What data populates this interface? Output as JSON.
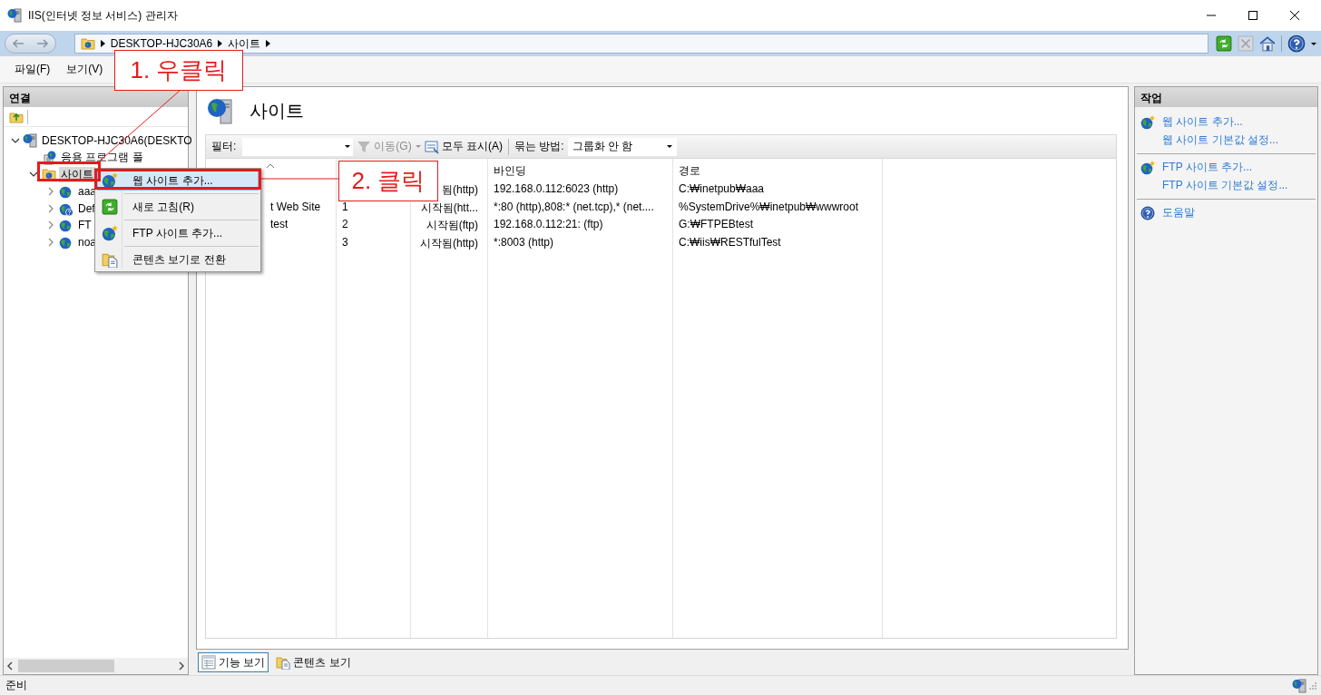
{
  "window": {
    "title": "IIS(인터넷 정보 서비스) 관리자"
  },
  "address_bar": {
    "crumbs": [
      "DESKTOP-HJC30A6",
      "사이트"
    ]
  },
  "menu_bar": [
    "파일(F)",
    "보기(V)"
  ],
  "connections": {
    "title": "연결",
    "tree": [
      {
        "label": "DESKTOP-HJC30A6(DESKTO",
        "kind": "server",
        "expanded": true,
        "selected": false,
        "children": [
          {
            "label": "응용 프로그램 풀",
            "kind": "pools",
            "selected": false
          },
          {
            "label": "사이트",
            "kind": "sites",
            "expanded": true,
            "selected": true,
            "children": [
              {
                "label": "aaa",
                "kind": "site",
                "expanded": false,
                "selected": false
              },
              {
                "label": "Def",
                "kind": "default-site",
                "expanded": false,
                "selected": false
              },
              {
                "label": "FT",
                "kind": "site",
                "expanded": false,
                "selected": false
              },
              {
                "label": "noa",
                "kind": "site",
                "expanded": false,
                "selected": false
              }
            ]
          }
        ]
      }
    ]
  },
  "content": {
    "title": "사이트",
    "toolbar": {
      "filter_label": "필터:",
      "go": {
        "label": "이동(G)",
        "disabled": true
      },
      "show_all": {
        "label": "모두 표시(A)",
        "disabled": false
      },
      "group_label": "묶는 방법:",
      "group_value": "그룹화 안 함"
    },
    "table": {
      "columns": [
        {
          "kind": "name"
        },
        {
          "kind": "id"
        },
        {
          "kind": "status"
        },
        {
          "kind": "binding",
          "title": "바인딩"
        },
        {
          "kind": "path",
          "title": "경로"
        }
      ],
      "rows": [
        {
          "status": "됨(http)",
          "binding": "192.168.0.112:6023 (http)",
          "path": "C:₩inetpub₩aaa"
        },
        {
          "name": "t Web Site",
          "id": "1",
          "status": "시작됨(htt...",
          "binding": "*:80 (http),808:* (net.tcp),* (net....",
          "path": "%SystemDrive%₩inetpub₩wwwroot"
        },
        {
          "name": "test",
          "id": "2",
          "status": "시작됨(ftp)",
          "binding": "192.168.0.112:21: (ftp)",
          "path": "G:₩FTPEBtest"
        },
        {
          "id": "3",
          "status": "시작됨(http)",
          "binding": "*:8003 (http)",
          "path": "C:₩iis₩RESTfulTest"
        }
      ]
    },
    "view_tabs": [
      {
        "label": "기능 보기",
        "kind": "features",
        "selected": true
      },
      {
        "label": "콘텐츠 보기",
        "kind": "content",
        "selected": false
      }
    ]
  },
  "actions": {
    "title": "작업",
    "items": [
      {
        "label": "웹 사이트 추가...",
        "kind": "add"
      },
      {
        "label": "웹 사이트 기본값 설정...",
        "kind": "plain"
      },
      {
        "kind": "separator"
      },
      {
        "label": "FTP 사이트 추가...",
        "kind": "add"
      },
      {
        "label": "FTP 사이트 기본값 설정...",
        "kind": "plain"
      },
      {
        "kind": "separator"
      },
      {
        "label": "도움말",
        "kind": "help"
      }
    ]
  },
  "context_menu": {
    "items": [
      {
        "label": "웹 사이트 추가...",
        "kind": "add",
        "selected": true
      },
      {
        "label": "새로 고침(R)",
        "kind": "refresh",
        "selected": false
      },
      {
        "label": "FTP 사이트 추가...",
        "kind": "add",
        "selected": false
      },
      {
        "label": "콘텐츠 보기로 전환",
        "kind": "content",
        "selected": false
      }
    ]
  },
  "annotations": [
    {
      "text": "1. 우클릭"
    },
    {
      "text": "2. 클릭"
    }
  ],
  "status_bar": {
    "text": "준비"
  }
}
